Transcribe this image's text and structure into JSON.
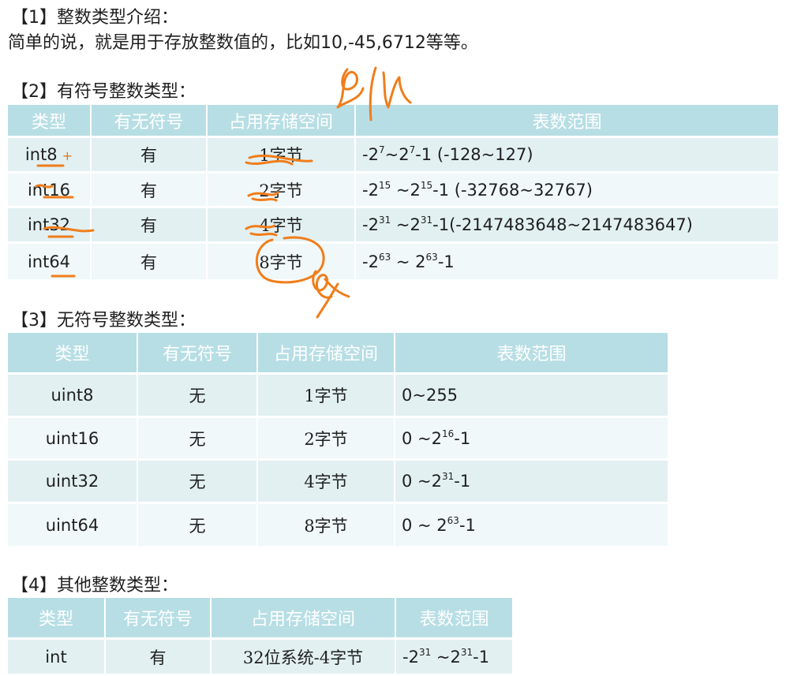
{
  "section1": {
    "heading": "【1】整数类型介绍：",
    "body": "简单的说，就是用于存放整数值的，比如10,-45,6712等等。"
  },
  "section2": {
    "heading": "【2】有符号整数类型：",
    "columns": [
      "类型",
      "有无符号",
      "占用存储空间",
      "表数范围"
    ],
    "rows": [
      {
        "type": "int8",
        "signed": "有",
        "storage": "1字节",
        "range_base": "-2",
        "range_exp1": "7",
        "range_mid": "~2",
        "range_exp2": "7",
        "range_tail": "-1 (-128~127)"
      },
      {
        "type": "int16",
        "signed": "有",
        "storage": "2字节",
        "range_base": "-2",
        "range_exp1": "15",
        "range_mid": " ~2",
        "range_exp2": "15",
        "range_tail": "-1 (-32768~32767)"
      },
      {
        "type": "int32",
        "signed": "有",
        "storage": "4字节",
        "range_base": "-2",
        "range_exp1": "31",
        "range_mid": " ~2",
        "range_exp2": "31",
        "range_tail": "-1(-2147483648~2147483647)"
      },
      {
        "type": "int64",
        "signed": "有",
        "storage": "8字节",
        "range_base": "-2",
        "range_exp1": "63",
        "range_mid": " ~ 2",
        "range_exp2": "63",
        "range_tail": "-1"
      }
    ],
    "plus_mark": "+"
  },
  "section3": {
    "heading": "【3】无符号整数类型：",
    "columns": [
      "类型",
      "有无符号",
      "占用存储空间",
      "表数范围"
    ],
    "rows": [
      {
        "type": "uint8",
        "signed": "无",
        "storage": "1字节",
        "range_base": "0~255",
        "range_exp": "",
        "range_tail": ""
      },
      {
        "type": "uint16",
        "signed": "无",
        "storage": "2字节",
        "range_base": "0 ~2",
        "range_exp": "16",
        "range_tail": "-1"
      },
      {
        "type": "uint32",
        "signed": "无",
        "storage": "4字节",
        "range_base": "0 ~2",
        "range_exp": "31",
        "range_tail": "-1"
      },
      {
        "type": "uint64",
        "signed": "无",
        "storage": "8字节",
        "range_base": "0 ~ 2",
        "range_exp": "63",
        "range_tail": "-1"
      }
    ]
  },
  "section4": {
    "heading": "【4】其他整数类型：",
    "columns": [
      "类型",
      "有无符号",
      "占用存储空间",
      "表数范围"
    ],
    "rows": [
      {
        "type": "int",
        "signed": "有",
        "storage": "32位系统-4字节",
        "range_base": "-2",
        "range_exp1": "31",
        "range_mid": " ~2",
        "range_exp2": "31",
        "range_tail": "-1"
      }
    ]
  },
  "annotation_color": "#f07d1a"
}
